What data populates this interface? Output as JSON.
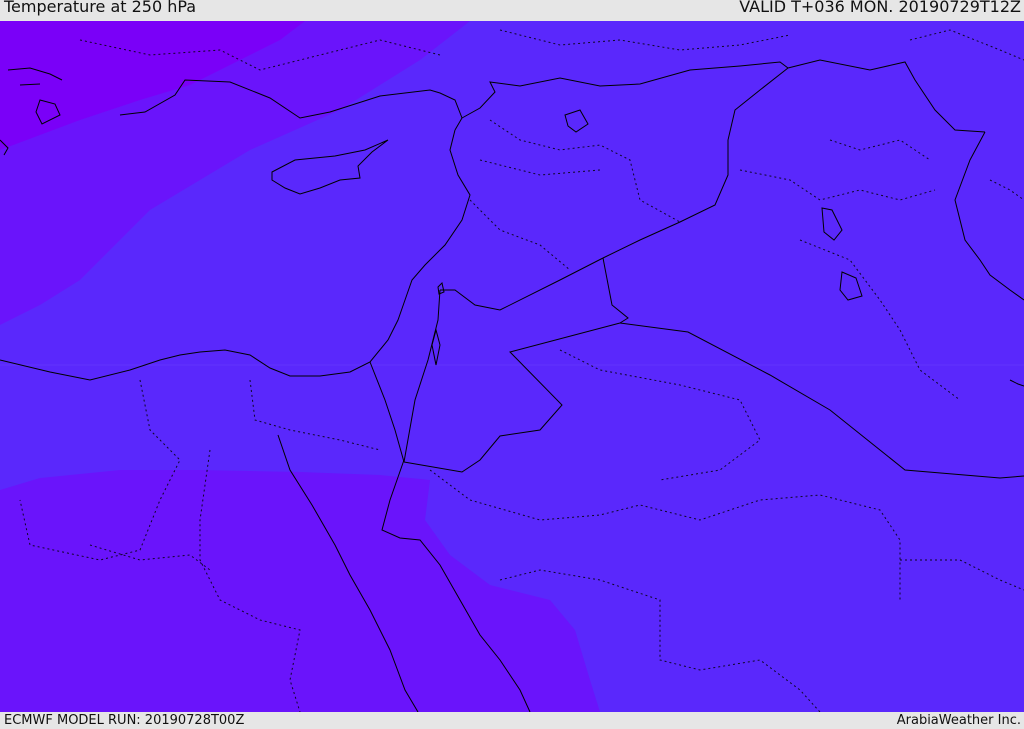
{
  "header": {
    "title": "Temperature at 250 hPa",
    "valid": "VALID T+036 MON. 20190729T12Z"
  },
  "footer": {
    "model_run": "ECMWF MODEL RUN: 20190728T00Z",
    "credit": "ArabiaWeather Inc."
  },
  "colors": {
    "cold_violet": "#7a00f8",
    "mid_purple": "#6a14fb",
    "base_blue": "#5a28fc",
    "border": "#000000",
    "frame_bg": "#e6e6e6"
  }
}
